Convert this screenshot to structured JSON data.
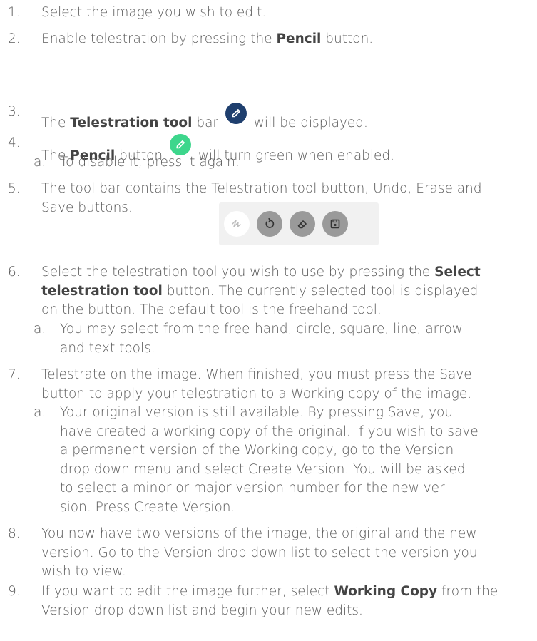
{
  "steps": [
    {
      "num": "1.",
      "text": "Select the image you wish to edit."
    },
    {
      "num": "2.",
      "pre": "Enable telestration by pressing the ",
      "bold": "Pencil",
      "post": " button."
    },
    {
      "num": "3.",
      "pre": "The ",
      "bold": "Telestration tool",
      "post_a": " bar ",
      "post_b": " will be displayed."
    },
    {
      "num": "4.",
      "pre": "The ",
      "bold": "Pencil",
      "post_a": " button ",
      "post_b": " will turn green when enabled."
    },
    {
      "num": "5.",
      "line1": "The tool bar contains the Telestration tool button, Undo, Erase and",
      "line2": "Save buttons."
    },
    {
      "num": "6.",
      "pre": "Select the telestration tool you wish to use by pressing the ",
      "bold": "Select",
      "bold2": "telestration tool",
      "post": " button. The currently selected tool is displayed",
      "line3": "on the button. The default tool is the freehand tool."
    },
    {
      "num": "7.",
      "line1": "Telestrate on the image. When finished, you must press the Save",
      "line2": "button to apply your telestration to a Working copy of the image."
    },
    {
      "num": "8.",
      "line1": "You now have two versions of the image, the original and the new",
      "line2": "version. Go to the Version drop down list to select the version you",
      "line3": "wish to view."
    },
    {
      "num": "9.",
      "pre": "If you want to edit the image further, select ",
      "bold": "Working Copy",
      "post": " from the",
      "line2": "Version drop down list and begin your new edits."
    }
  ],
  "substeps": {
    "s4a": {
      "num": "a.",
      "text": "To disable it, press it again."
    },
    "s6a": {
      "num": "a.",
      "line1": "You may select from the free-hand, circle, square, line, arrow",
      "line2": "and text tools."
    },
    "s7a": {
      "num": "a.",
      "line1": "Your original version is still available. By pressing Save, you",
      "line2": "have created a working copy of the original. If you wish to save",
      "line3": "a permanent version of the Working copy, go to the Version",
      "line4": "drop down menu and select Create Version. You will be asked",
      "line5": "to select a minor or major version number for the new ver-",
      "line6": "sion. Press Create Version."
    }
  },
  "icons": {
    "telestration_bar_icon": "pencil-icon",
    "telestration_bar_color": "#1f3f6e",
    "pencil_enabled_icon": "pencil-icon",
    "pencil_enabled_color": "#3dd68c",
    "toolbar_buttons": [
      "freehand-tool-icon",
      "undo-icon",
      "erase-icon",
      "save-icon"
    ],
    "toolbar_button_color": "#9a9a9a",
    "toolbar_bg": "#f1f1f1"
  }
}
